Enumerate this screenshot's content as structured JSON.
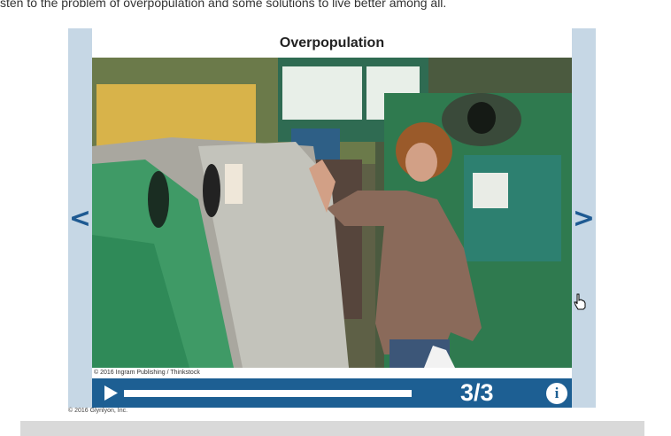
{
  "intro_text": "sten to the problem of overpopulation and some solutions to live better among all.",
  "slide": {
    "title": "Overpopulation",
    "image_credit": "© 2016 Ingram Publishing / Thinkstock",
    "counter": "3/3",
    "current": 3,
    "total": 3,
    "progress": 1.0
  },
  "nav": {
    "prev_symbol": "<",
    "next_symbol": ">"
  },
  "info_symbol": "i",
  "copyright": "© 2016 Glynlyon, Inc.",
  "icons": [
    "chevron-left-icon",
    "chevron-right-icon",
    "play-icon",
    "info-icon",
    "hand-cursor-icon"
  ],
  "colors": {
    "nav_bg": "#c6d7e5",
    "accent": "#1d5f93",
    "arrow": "#1e5a92"
  }
}
